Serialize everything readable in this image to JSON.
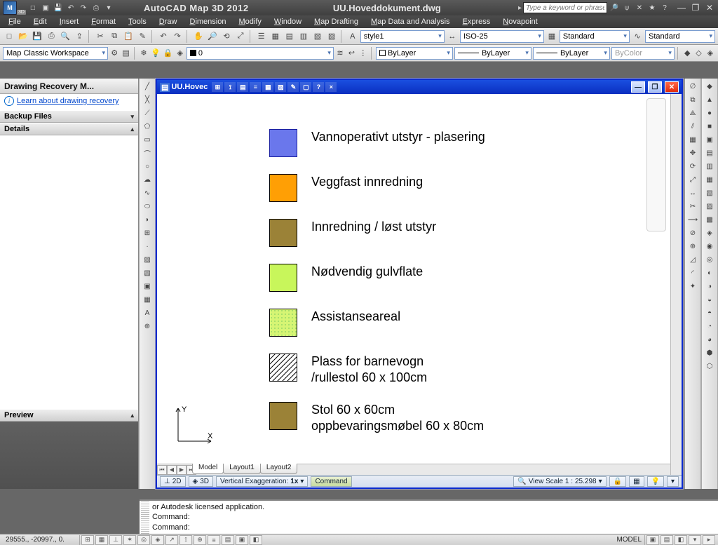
{
  "app": {
    "title": "AutoCAD Map 3D 2012",
    "document": "UU.Hoveddokument.dwg",
    "search_placeholder": "Type a keyword or phrase"
  },
  "menus": [
    "File",
    "Edit",
    "Insert",
    "Format",
    "Tools",
    "Draw",
    "Dimension",
    "Modify",
    "Window",
    "Map Drafting",
    "Map Data and Analysis",
    "Express",
    "Novapoint"
  ],
  "workspace": {
    "selected": "Map Classic Workspace"
  },
  "layer": {
    "current": "0",
    "bylayer": "ByLayer",
    "bycolor": "ByColor"
  },
  "styles": {
    "text": "style1",
    "dim": "ISO-25",
    "table1": "Standard",
    "table2": "Standard"
  },
  "recovery": {
    "title": "Drawing Recovery M...",
    "learn_link": "Learn about drawing recovery",
    "backup_header": "Backup Files",
    "details_header": "Details",
    "preview_header": "Preview"
  },
  "doc_window": {
    "title": "UU.Hovec"
  },
  "legend": [
    {
      "label": "Vannoperativt utstyr - plasering",
      "fill": "#6a77ec",
      "border": "#1a1fa0",
      "pattern": "solid"
    },
    {
      "label": "Veggfast innredning",
      "fill": "#ff9f05",
      "border": "#000",
      "pattern": "solid"
    },
    {
      "label": "Innredning / løst utstyr",
      "fill": "#9b8237",
      "border": "#000",
      "pattern": "solid"
    },
    {
      "label": "Nødvendig gulvflate",
      "fill": "#c8f65b",
      "border": "#000",
      "pattern": "solid"
    },
    {
      "label": "Assistanseareal",
      "fill": "#d6f574",
      "border": "#000",
      "pattern": "dots"
    },
    {
      "label": "Plass for barnevogn\n/rullestol 60 x 100cm",
      "fill": "#ffffff",
      "border": "#000",
      "pattern": "diag"
    },
    {
      "label": "Stol 60 x 60cm\noppbevaringsmøbel 60 x 80cm",
      "fill": "#9b8237",
      "border": "#000",
      "pattern": "solid"
    }
  ],
  "layout_tabs": [
    "Model",
    "Layout1",
    "Layout2"
  ],
  "drawing_status": {
    "btn_2d": "2D",
    "btn_3d": "3D",
    "vert_ex": "Vertical Exaggeration:",
    "vert_val": "1x",
    "cmd_label": "Command",
    "view_label": "View Scale  1 :",
    "view_val": "25.298"
  },
  "command": {
    "line1": "or Autodesk licensed application.",
    "line2": "Command:",
    "line3": "Command:"
  },
  "status": {
    "coords": "29555., -20997., 0.",
    "model": "MODEL"
  }
}
